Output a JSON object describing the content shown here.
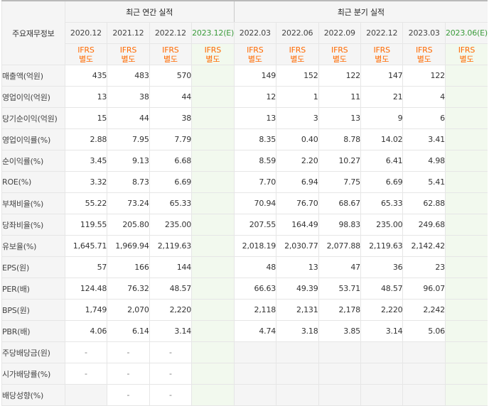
{
  "corner_label": "주요재무정보",
  "group_headers": {
    "annual": "최근 연간 실적",
    "quarterly": "최근 분기 실적"
  },
  "periods": [
    "2020.12",
    "2021.12",
    "2022.12",
    "2023.12(E)",
    "2022.03",
    "2022.06",
    "2022.09",
    "2022.12",
    "2023.03",
    "2023.06(E)"
  ],
  "standard_line1": "IFRS",
  "standard_line2": "별도",
  "rows": [
    {
      "label": "매출액(억원)",
      "values": [
        "435",
        "483",
        "570",
        "",
        "149",
        "152",
        "122",
        "147",
        "122",
        ""
      ]
    },
    {
      "label": "영업이익(억원)",
      "values": [
        "13",
        "38",
        "44",
        "",
        "12",
        "1",
        "11",
        "21",
        "4",
        ""
      ]
    },
    {
      "label": "당기순이익(억원)",
      "values": [
        "15",
        "44",
        "38",
        "",
        "13",
        "3",
        "13",
        "9",
        "6",
        ""
      ]
    },
    {
      "label": "영업이익률(%)",
      "values": [
        "2.88",
        "7.95",
        "7.79",
        "",
        "8.35",
        "0.40",
        "8.78",
        "14.02",
        "3.41",
        ""
      ]
    },
    {
      "label": "순이익률(%)",
      "values": [
        "3.45",
        "9.13",
        "6.68",
        "",
        "8.59",
        "2.20",
        "10.27",
        "6.41",
        "4.98",
        ""
      ]
    },
    {
      "label": "ROE(%)",
      "values": [
        "3.32",
        "8.73",
        "6.69",
        "",
        "7.70",
        "6.94",
        "7.75",
        "6.69",
        "5.41",
        ""
      ]
    },
    {
      "label": "부채비율(%)",
      "values": [
        "55.22",
        "73.24",
        "65.33",
        "",
        "70.94",
        "76.70",
        "68.67",
        "65.33",
        "62.88",
        ""
      ]
    },
    {
      "label": "당좌비율(%)",
      "values": [
        "119.55",
        "205.80",
        "235.00",
        "",
        "207.55",
        "164.49",
        "98.83",
        "235.00",
        "249.68",
        ""
      ]
    },
    {
      "label": "유보율(%)",
      "values": [
        "1,645.71",
        "1,969.94",
        "2,119.63",
        "",
        "2,018.19",
        "2,030.77",
        "2,077.88",
        "2,119.63",
        "2,142.42",
        ""
      ]
    },
    {
      "label": "EPS(원)",
      "values": [
        "57",
        "166",
        "144",
        "",
        "48",
        "13",
        "47",
        "36",
        "23",
        ""
      ]
    },
    {
      "label": "PER(배)",
      "values": [
        "124.48",
        "76.32",
        "48.57",
        "",
        "66.63",
        "49.39",
        "53.71",
        "48.57",
        "96.07",
        ""
      ]
    },
    {
      "label": "BPS(원)",
      "values": [
        "1,749",
        "2,070",
        "2,220",
        "",
        "2,118",
        "2,131",
        "2,178",
        "2,220",
        "2,242",
        ""
      ]
    },
    {
      "label": "PBR(배)",
      "values": [
        "4.06",
        "6.14",
        "3.14",
        "",
        "4.74",
        "3.18",
        "3.85",
        "3.14",
        "5.06",
        ""
      ]
    },
    {
      "label": "주당배당금(원)",
      "values": [
        "-",
        "-",
        "-",
        "",
        "",
        "",
        "",
        "",
        "",
        ""
      ]
    },
    {
      "label": "시가배당률(%)",
      "values": [
        "-",
        "-",
        "-",
        "",
        "",
        "",
        "",
        "",
        "",
        ""
      ]
    },
    {
      "label": "배당성향(%)",
      "values": [
        "",
        "-",
        "-",
        "",
        "",
        "",
        "",
        "",
        "",
        ""
      ]
    }
  ]
}
